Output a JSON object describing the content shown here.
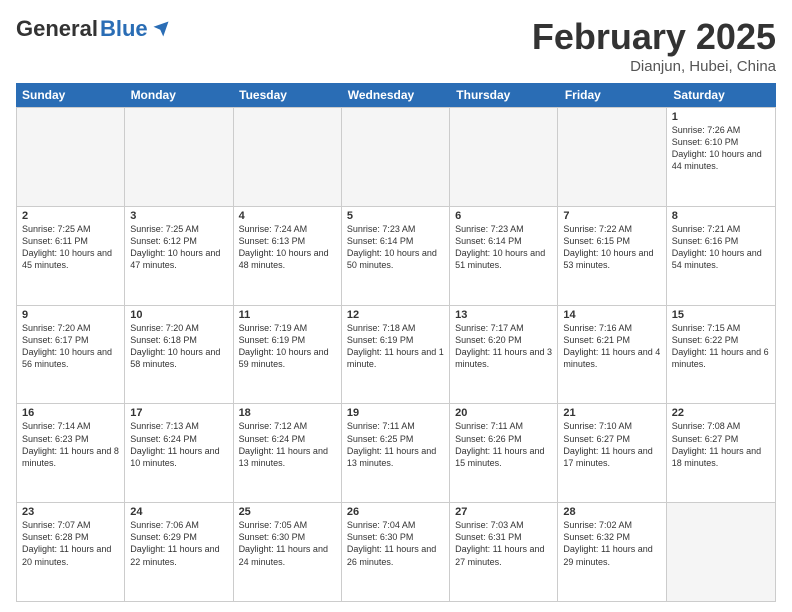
{
  "header": {
    "logo_general": "General",
    "logo_blue": "Blue",
    "month_title": "February 2025",
    "location": "Dianjun, Hubei, China"
  },
  "weekdays": [
    "Sunday",
    "Monday",
    "Tuesday",
    "Wednesday",
    "Thursday",
    "Friday",
    "Saturday"
  ],
  "rows": [
    [
      {
        "day": "",
        "empty": true
      },
      {
        "day": "",
        "empty": true
      },
      {
        "day": "",
        "empty": true
      },
      {
        "day": "",
        "empty": true
      },
      {
        "day": "",
        "empty": true
      },
      {
        "day": "",
        "empty": true
      },
      {
        "day": "1",
        "sunrise": "Sunrise: 7:26 AM",
        "sunset": "Sunset: 6:10 PM",
        "daylight": "Daylight: 10 hours and 44 minutes."
      }
    ],
    [
      {
        "day": "2",
        "sunrise": "Sunrise: 7:25 AM",
        "sunset": "Sunset: 6:11 PM",
        "daylight": "Daylight: 10 hours and 45 minutes."
      },
      {
        "day": "3",
        "sunrise": "Sunrise: 7:25 AM",
        "sunset": "Sunset: 6:12 PM",
        "daylight": "Daylight: 10 hours and 47 minutes."
      },
      {
        "day": "4",
        "sunrise": "Sunrise: 7:24 AM",
        "sunset": "Sunset: 6:13 PM",
        "daylight": "Daylight: 10 hours and 48 minutes."
      },
      {
        "day": "5",
        "sunrise": "Sunrise: 7:23 AM",
        "sunset": "Sunset: 6:14 PM",
        "daylight": "Daylight: 10 hours and 50 minutes."
      },
      {
        "day": "6",
        "sunrise": "Sunrise: 7:23 AM",
        "sunset": "Sunset: 6:14 PM",
        "daylight": "Daylight: 10 hours and 51 minutes."
      },
      {
        "day": "7",
        "sunrise": "Sunrise: 7:22 AM",
        "sunset": "Sunset: 6:15 PM",
        "daylight": "Daylight: 10 hours and 53 minutes."
      },
      {
        "day": "8",
        "sunrise": "Sunrise: 7:21 AM",
        "sunset": "Sunset: 6:16 PM",
        "daylight": "Daylight: 10 hours and 54 minutes."
      }
    ],
    [
      {
        "day": "9",
        "sunrise": "Sunrise: 7:20 AM",
        "sunset": "Sunset: 6:17 PM",
        "daylight": "Daylight: 10 hours and 56 minutes."
      },
      {
        "day": "10",
        "sunrise": "Sunrise: 7:20 AM",
        "sunset": "Sunset: 6:18 PM",
        "daylight": "Daylight: 10 hours and 58 minutes."
      },
      {
        "day": "11",
        "sunrise": "Sunrise: 7:19 AM",
        "sunset": "Sunset: 6:19 PM",
        "daylight": "Daylight: 10 hours and 59 minutes."
      },
      {
        "day": "12",
        "sunrise": "Sunrise: 7:18 AM",
        "sunset": "Sunset: 6:19 PM",
        "daylight": "Daylight: 11 hours and 1 minute."
      },
      {
        "day": "13",
        "sunrise": "Sunrise: 7:17 AM",
        "sunset": "Sunset: 6:20 PM",
        "daylight": "Daylight: 11 hours and 3 minutes."
      },
      {
        "day": "14",
        "sunrise": "Sunrise: 7:16 AM",
        "sunset": "Sunset: 6:21 PM",
        "daylight": "Daylight: 11 hours and 4 minutes."
      },
      {
        "day": "15",
        "sunrise": "Sunrise: 7:15 AM",
        "sunset": "Sunset: 6:22 PM",
        "daylight": "Daylight: 11 hours and 6 minutes."
      }
    ],
    [
      {
        "day": "16",
        "sunrise": "Sunrise: 7:14 AM",
        "sunset": "Sunset: 6:23 PM",
        "daylight": "Daylight: 11 hours and 8 minutes."
      },
      {
        "day": "17",
        "sunrise": "Sunrise: 7:13 AM",
        "sunset": "Sunset: 6:24 PM",
        "daylight": "Daylight: 11 hours and 10 minutes."
      },
      {
        "day": "18",
        "sunrise": "Sunrise: 7:12 AM",
        "sunset": "Sunset: 6:24 PM",
        "daylight": "Daylight: 11 hours and 13 minutes."
      },
      {
        "day": "19",
        "sunrise": "Sunrise: 7:11 AM",
        "sunset": "Sunset: 6:25 PM",
        "daylight": "Daylight: 11 hours and 13 minutes."
      },
      {
        "day": "20",
        "sunrise": "Sunrise: 7:11 AM",
        "sunset": "Sunset: 6:26 PM",
        "daylight": "Daylight: 11 hours and 15 minutes."
      },
      {
        "day": "21",
        "sunrise": "Sunrise: 7:10 AM",
        "sunset": "Sunset: 6:27 PM",
        "daylight": "Daylight: 11 hours and 17 minutes."
      },
      {
        "day": "22",
        "sunrise": "Sunrise: 7:08 AM",
        "sunset": "Sunset: 6:27 PM",
        "daylight": "Daylight: 11 hours and 18 minutes."
      }
    ],
    [
      {
        "day": "23",
        "sunrise": "Sunrise: 7:07 AM",
        "sunset": "Sunset: 6:28 PM",
        "daylight": "Daylight: 11 hours and 20 minutes."
      },
      {
        "day": "24",
        "sunrise": "Sunrise: 7:06 AM",
        "sunset": "Sunset: 6:29 PM",
        "daylight": "Daylight: 11 hours and 22 minutes."
      },
      {
        "day": "25",
        "sunrise": "Sunrise: 7:05 AM",
        "sunset": "Sunset: 6:30 PM",
        "daylight": "Daylight: 11 hours and 24 minutes."
      },
      {
        "day": "26",
        "sunrise": "Sunrise: 7:04 AM",
        "sunset": "Sunset: 6:30 PM",
        "daylight": "Daylight: 11 hours and 26 minutes."
      },
      {
        "day": "27",
        "sunrise": "Sunrise: 7:03 AM",
        "sunset": "Sunset: 6:31 PM",
        "daylight": "Daylight: 11 hours and 27 minutes."
      },
      {
        "day": "28",
        "sunrise": "Sunrise: 7:02 AM",
        "sunset": "Sunset: 6:32 PM",
        "daylight": "Daylight: 11 hours and 29 minutes."
      },
      {
        "day": "",
        "empty": true
      }
    ]
  ]
}
